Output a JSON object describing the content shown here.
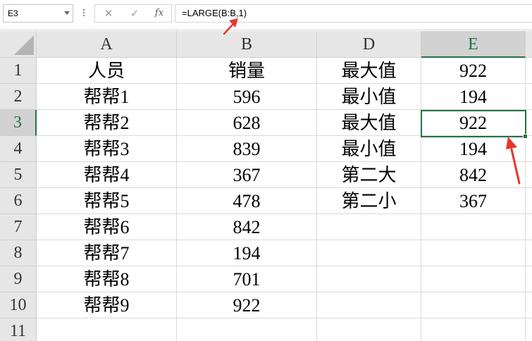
{
  "formula_bar": {
    "name_box": "E3",
    "cancel_icon": "✕",
    "confirm_icon": "✓",
    "function_icon": "fx",
    "formula": "=LARGE(B:B,1)"
  },
  "columns": [
    "A",
    "B",
    "D",
    "E"
  ],
  "active_column": "E",
  "active_row": "3",
  "rows": [
    {
      "num": "1",
      "A": "人员",
      "B": "销量",
      "D": "最大值",
      "E": "922"
    },
    {
      "num": "2",
      "A": "帮帮1",
      "B": "596",
      "D": "最小值",
      "E": "194"
    },
    {
      "num": "3",
      "A": "帮帮2",
      "B": "628",
      "D": "最大值",
      "E": "922"
    },
    {
      "num": "4",
      "A": "帮帮3",
      "B": "839",
      "D": "最小值",
      "E": "194"
    },
    {
      "num": "5",
      "A": "帮帮4",
      "B": "367",
      "D": "第二大",
      "E": "842"
    },
    {
      "num": "6",
      "A": "帮帮5",
      "B": "478",
      "D": "第二小",
      "E": "367"
    },
    {
      "num": "7",
      "A": "帮帮6",
      "B": "842",
      "D": "",
      "E": ""
    },
    {
      "num": "8",
      "A": "帮帮7",
      "B": "194",
      "D": "",
      "E": ""
    },
    {
      "num": "9",
      "A": "帮帮8",
      "B": "701",
      "D": "",
      "E": ""
    },
    {
      "num": "10",
      "A": "帮帮9",
      "B": "922",
      "D": "",
      "E": ""
    },
    {
      "num": "11",
      "A": "",
      "B": "",
      "D": "",
      "E": ""
    }
  ],
  "colors": {
    "accent": "#217346",
    "annotation_arrow": "#e8352a",
    "header_bg": "#e6e6e6"
  },
  "icons": {
    "corner": "select-all-triangle-icon",
    "dropdown": "chevron-down-icon"
  }
}
